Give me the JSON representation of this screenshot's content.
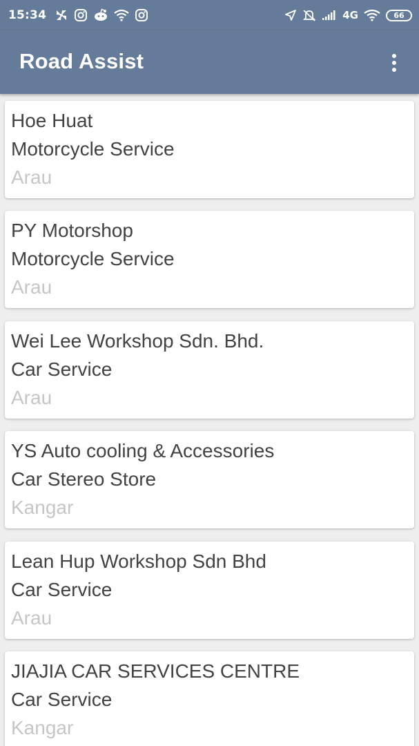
{
  "status_bar": {
    "time": "15:34",
    "network_type": "4G",
    "battery_level": "66"
  },
  "app_bar": {
    "title": "Road Assist",
    "menu_icon": "more-vert-icon"
  },
  "colors": {
    "app_bar": "#647c99",
    "background": "#eeeeee",
    "card": "#ffffff",
    "primary_text": "#424242",
    "secondary_text": "#c6c6c6"
  },
  "workshops": [
    {
      "name": "Hoe Huat",
      "category": "Motorcycle Service",
      "location": "Arau"
    },
    {
      "name": "PY Motorshop",
      "category": "Motorcycle Service",
      "location": "Arau"
    },
    {
      "name": "Wei Lee Workshop Sdn. Bhd.",
      "category": "Car Service",
      "location": "Arau"
    },
    {
      "name": "YS Auto cooling & Accessories",
      "category": "Car Stereo Store",
      "location": "Kangar"
    },
    {
      "name": "Lean Hup Workshop Sdn Bhd",
      "category": "Car Service",
      "location": "Arau"
    },
    {
      "name": "JIAJIA CAR SERVICES CENTRE",
      "category": "Car Service",
      "location": "Kangar"
    }
  ]
}
